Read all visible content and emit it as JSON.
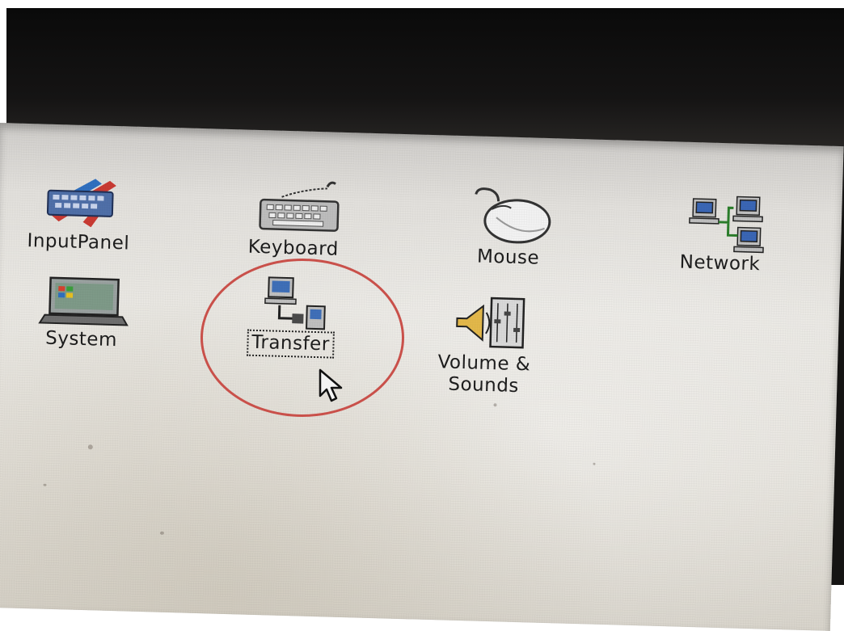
{
  "desktop": {
    "items": [
      {
        "id": "inputpanel",
        "label": "InputPanel",
        "icon": "input-panel-icon",
        "selected": false
      },
      {
        "id": "keyboard",
        "label": "Keyboard",
        "icon": "keyboard-icon",
        "selected": false
      },
      {
        "id": "mouse",
        "label": "Mouse",
        "icon": "mouse-icon",
        "selected": false
      },
      {
        "id": "network",
        "label": "Network",
        "icon": "network-icon",
        "selected": false
      },
      {
        "id": "system",
        "label": "System",
        "icon": "system-icon",
        "selected": false
      },
      {
        "id": "transfer",
        "label": "Transfer",
        "icon": "transfer-icon",
        "selected": true
      },
      {
        "id": "volume",
        "label_line1": "Volume &",
        "label_line2": "Sounds",
        "icon": "volume-sounds-icon",
        "selected": false
      }
    ]
  },
  "annotation": {
    "shape": "ellipse",
    "color": "#c9504a",
    "target": "transfer"
  },
  "cursor": {
    "icon": "arrow-cursor-icon"
  }
}
